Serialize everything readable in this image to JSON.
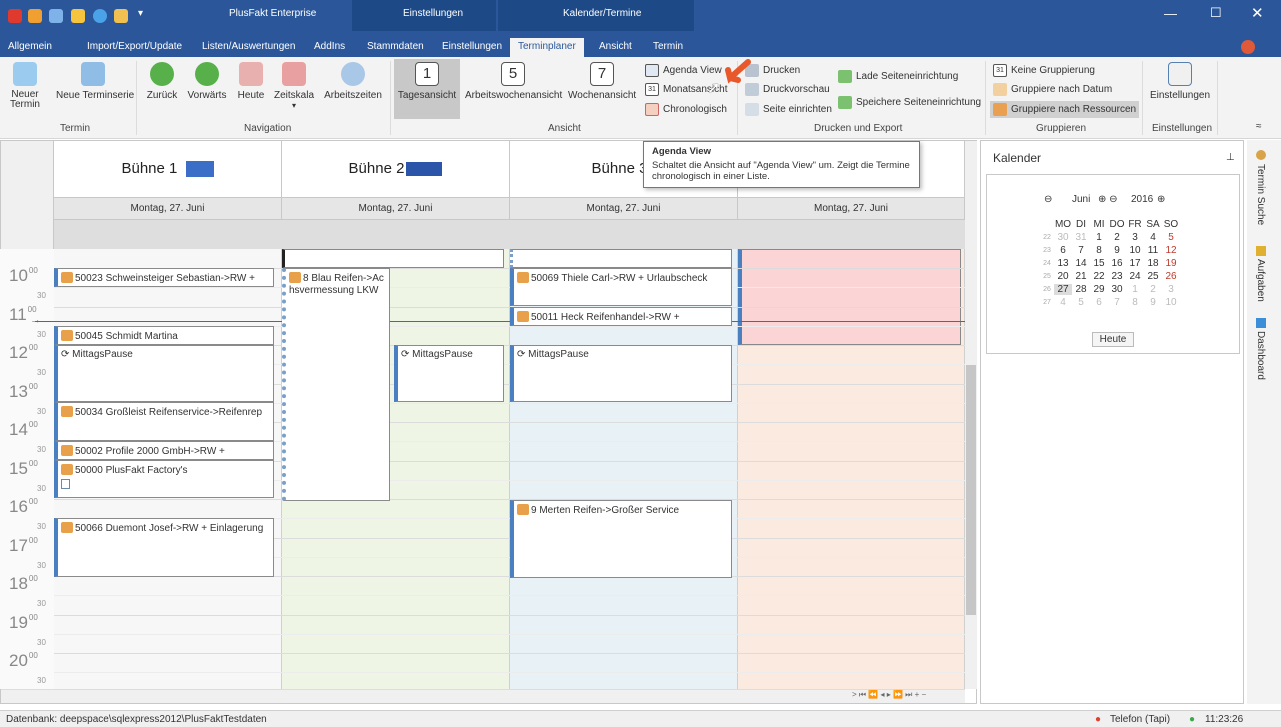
{
  "window": {
    "app_title": "PlusFakt Enterprise",
    "context_tab_settings": "Einstellungen",
    "context_tab_calendar": "Kalender/Termine"
  },
  "tabs": [
    "Allgemein",
    "Import/Export/Update",
    "Listen/Auswertungen",
    "AddIns",
    "Stammdaten",
    "Einstellungen",
    "Terminplaner",
    "Ansicht",
    "Termin"
  ],
  "ribbon": {
    "termin": {
      "new": "Neuer Termin",
      "series": "Neue Terminserie",
      "group": "Termin"
    },
    "navigation": {
      "back": "Zurück",
      "forward": "Vorwärts",
      "today": "Heute",
      "scale": "Zeitskala",
      "worktime": "Arbeitszeiten",
      "group": "Navigation"
    },
    "view": {
      "day": "Tagesansicht",
      "workweek": "Arbeitswochenansicht",
      "week": "Wochenansicht",
      "agenda": "Agenda View",
      "month": "Monatsansicht",
      "chrono": "Chronologisch",
      "group": "Ansicht",
      "day_icon": "1",
      "workweek_icon": "5",
      "week_icon": "7",
      "month_icon": "31"
    },
    "print": {
      "print": "Drucken",
      "preview": "Druckvorschau",
      "setup": "Seite einrichten",
      "load": "Lade Seiteneinrichtung",
      "save": "Speichere Seiteneinrichtung",
      "group": "Drucken und Export"
    },
    "grouping": {
      "none": "Keine Gruppierung",
      "date": "Gruppiere nach Datum",
      "resource": "Gruppiere nach Ressourcen",
      "group": "Gruppieren",
      "none_icon": "31"
    },
    "settings": {
      "label": "Einstellungen",
      "group": "Einstellungen"
    }
  },
  "tooltip": {
    "title": "Agenda View",
    "text": "Schaltet die Ansicht auf \"Agenda View\" um. Zeigt die Termine chronologisch in einer Liste."
  },
  "scheduler": {
    "resources": [
      "Bühne 1",
      "Bühne 2",
      "Bühne 3",
      ""
    ],
    "date": "Montag, 27. Juni",
    "hours": [
      "10",
      "11",
      "12",
      "13",
      "14",
      "15",
      "16",
      "17",
      "18",
      "19",
      "20"
    ],
    "minutes_full": "00",
    "minutes_half": "30",
    "appointments": {
      "a1": "50023 Schweinsteiger Sebastian->RW +",
      "a2": "50045 Schmidt Martina",
      "a3": "MittagsPause",
      "a4": "50034 Großleist Reifenservice->Reifenrep",
      "a5": "50002 Profile 2000 GmbH->RW +",
      "a6": "50000 PlusFakt Factory's",
      "a7": "50066 Duemont Josef->RW + Einlagerung",
      "b1": "8 Blau Reifen->Achsvermessung LKW",
      "b2": "MittagsPause",
      "c1": "50069 Thiele Carl->RW + Urlaubscheck",
      "c2": "50011 Heck Reifenhandel->RW +",
      "c3": "MittagsPause",
      "c4": "9 Merten Reifen->Großer Service"
    }
  },
  "calendar": {
    "title": "Kalender",
    "month": "Juni",
    "year": "2016",
    "weekdays": [
      "MO",
      "DI",
      "MI",
      "DO",
      "FR",
      "SA",
      "SO"
    ],
    "weeks": [
      {
        "wk": "22",
        "days": [
          "30",
          "31",
          "1",
          "2",
          "3",
          "4",
          "5"
        ]
      },
      {
        "wk": "23",
        "days": [
          "6",
          "7",
          "8",
          "9",
          "10",
          "11",
          "12"
        ]
      },
      {
        "wk": "24",
        "days": [
          "13",
          "14",
          "15",
          "16",
          "17",
          "18",
          "19"
        ]
      },
      {
        "wk": "25",
        "days": [
          "20",
          "21",
          "22",
          "23",
          "24",
          "25",
          "26"
        ]
      },
      {
        "wk": "26",
        "days": [
          "27",
          "28",
          "29",
          "30",
          "1",
          "2",
          "3"
        ]
      },
      {
        "wk": "27",
        "days": [
          "4",
          "5",
          "6",
          "7",
          "8",
          "9",
          "10"
        ]
      }
    ],
    "today_button": "Heute"
  },
  "side_tabs": [
    "Termin Suche",
    "Aufgaben",
    "Dashboard"
  ],
  "status": {
    "db": "Datenbank: deepspace\\sqlexpress2012\\PlusFaktTestdaten",
    "phone": "Telefon (Tapi)",
    "time": "11:23:26"
  },
  "colors": {
    "accent": "#2b579a",
    "col2": "#eef5e4",
    "col3": "#e8f1f6",
    "col4": "#fbeadf",
    "selected": "#fbd5d5"
  }
}
